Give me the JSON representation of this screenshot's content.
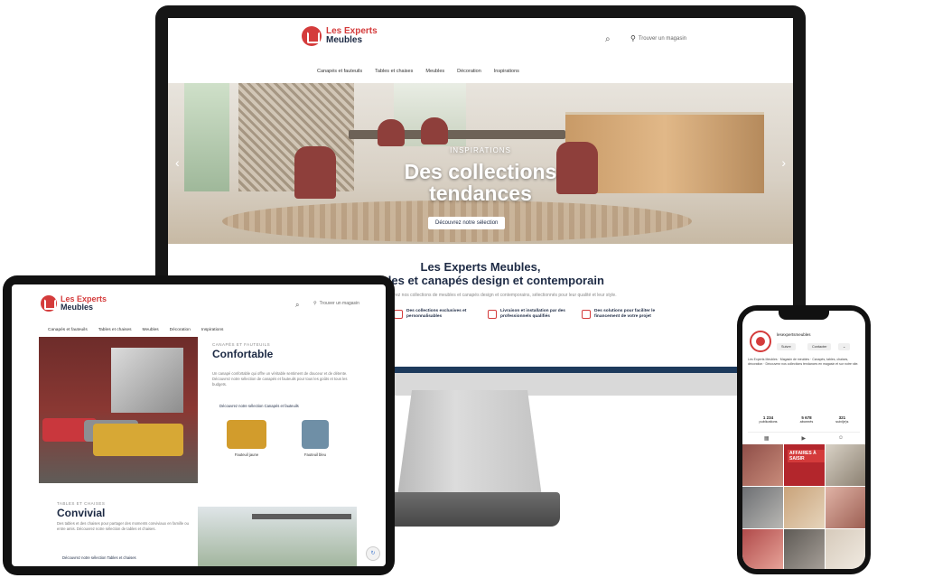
{
  "desktop": {
    "logo": {
      "line1": "Les Experts",
      "line2": "Meubles"
    },
    "store_label": "Trouver un magasin",
    "nav": [
      "Canapés et fauteuils",
      "Tables et chaises",
      "Meubles",
      "Décoration",
      "Inspirations"
    ],
    "hero": {
      "kicker": "INSPIRATIONS",
      "title_line1": "Des collections",
      "title_line2": "tendances",
      "button": "Découvrez notre sélection",
      "prev_arrow": "‹",
      "next_arrow": "›"
    },
    "intro": {
      "title_line1": "Les Experts Meubles,",
      "title_line2": "meubles et canapés design et contemporain",
      "body": "Découvrez nos collections de meubles et canapés design et contemporains, sélectionnés pour leur qualité et leur style."
    },
    "features": [
      "Des collections exclusives et personnalisables",
      "Livraison et installation par des professionnels qualifiés",
      "Des solutions pour faciliter le financement de votre projet"
    ]
  },
  "tablet": {
    "logo": {
      "line1": "Les Experts",
      "line2": "Meubles"
    },
    "store_label": "Trouver un magasin",
    "nav": [
      "Canapés et fauteuils",
      "Tables et chaises",
      "Meubles",
      "Décoration",
      "Inspirations"
    ],
    "section1": {
      "kicker": "CANAPÉS ET FAUTEUILS",
      "title": "Confortable",
      "body": "Un canapé confortable qui offre un véritable sentiment de douceur et de détente. Découvrez notre sélection de canapés et fauteuils pour tous les goûts et tous les budgets.",
      "link": "Découvrez notre sélection Canapés et fauteuils",
      "products": [
        "Fauteuil jaune",
        "Fauteuil bleu"
      ]
    },
    "section2": {
      "kicker": "TABLES ET CHAISES",
      "title": "Convivial",
      "body": "Des tables et des chaises pour partager des moments conviviaux en famille ou entre amis. Découvrez notre sélection de tables et chaises.",
      "link": "Découvrez notre sélection Tables et chaises"
    },
    "recaptcha_icon": "↻"
  },
  "phone": {
    "profile_name": "lesexpertsmeubles",
    "buttons": [
      "Suivre",
      "Contacter",
      "⌄"
    ],
    "bio": "Les Experts Meubles · Magasin de meubles · Canapés, tables, chaises, décoration · Découvrez nos collections tendances en magasin et sur notre site.",
    "stats": [
      {
        "value": "1 234",
        "label": "publications"
      },
      {
        "value": "5 678",
        "label": "abonnés"
      },
      {
        "value": "321",
        "label": "suivi(e)s"
      }
    ],
    "tabs": [
      "▦",
      "▶",
      "☺"
    ],
    "grid_tag": "AFFAIRES À SAISIR"
  },
  "colors": {
    "brand_red": "#d43b3b",
    "brand_navy": "#1d2a44"
  }
}
